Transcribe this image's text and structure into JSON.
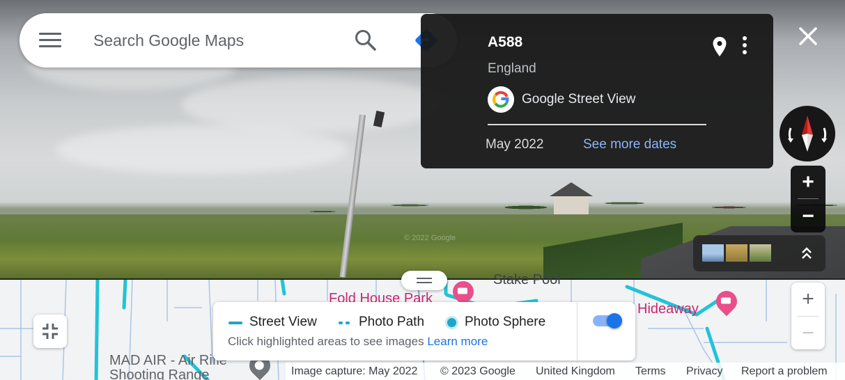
{
  "search": {
    "placeholder": "Search Google Maps",
    "icons": {
      "menu": "hamburger-menu-icon",
      "search": "magnifier-icon",
      "directions": "directions-diamond-icon"
    }
  },
  "info_card": {
    "title": "A588",
    "region": "England",
    "provider": "Google Street View",
    "date": "May 2022",
    "see_more": "See more dates",
    "icons": {
      "logo": "google-g-logo",
      "pin": "map-pin-icon",
      "more": "vertical-dots-icon"
    }
  },
  "street_view": {
    "watermark": "© 2022 Google",
    "zoom_in": "+",
    "zoom_out": "−",
    "icons": {
      "close": "close-x-icon",
      "compass": "compass-icon",
      "expand": "double-chevron-up-icon"
    }
  },
  "map": {
    "poi": [
      {
        "label": "Fold House Park",
        "icon": "hotel-icon"
      },
      {
        "label": "Hideaway",
        "icon": "hotel-icon"
      },
      {
        "label": "MAD AIR - Air Rifle Shooting Range",
        "icon": "place-pin-icon"
      }
    ],
    "partial_label": "Stake Pool",
    "zoom_in": "+",
    "zoom_out": "−"
  },
  "legend": {
    "items": [
      {
        "label": "Street View",
        "symbol": "solid-line"
      },
      {
        "label": "Photo Path",
        "symbol": "dotted-line"
      },
      {
        "label": "Photo Sphere",
        "symbol": "circle"
      }
    ],
    "hint": "Click highlighted areas to see images",
    "learn_more": "Learn more",
    "toggle_on": true
  },
  "footer": {
    "capture": "Image capture: May 2022",
    "copyright": "© 2023 Google",
    "region": "United Kingdom",
    "terms": "Terms",
    "privacy": "Privacy",
    "report": "Report a problem"
  },
  "colors": {
    "street_view_coverage": "#1ca7c8",
    "link_blue": "#1a73e8",
    "link_blue_dark": "#8ab4f8",
    "poi_pink": "#e94f8a"
  }
}
